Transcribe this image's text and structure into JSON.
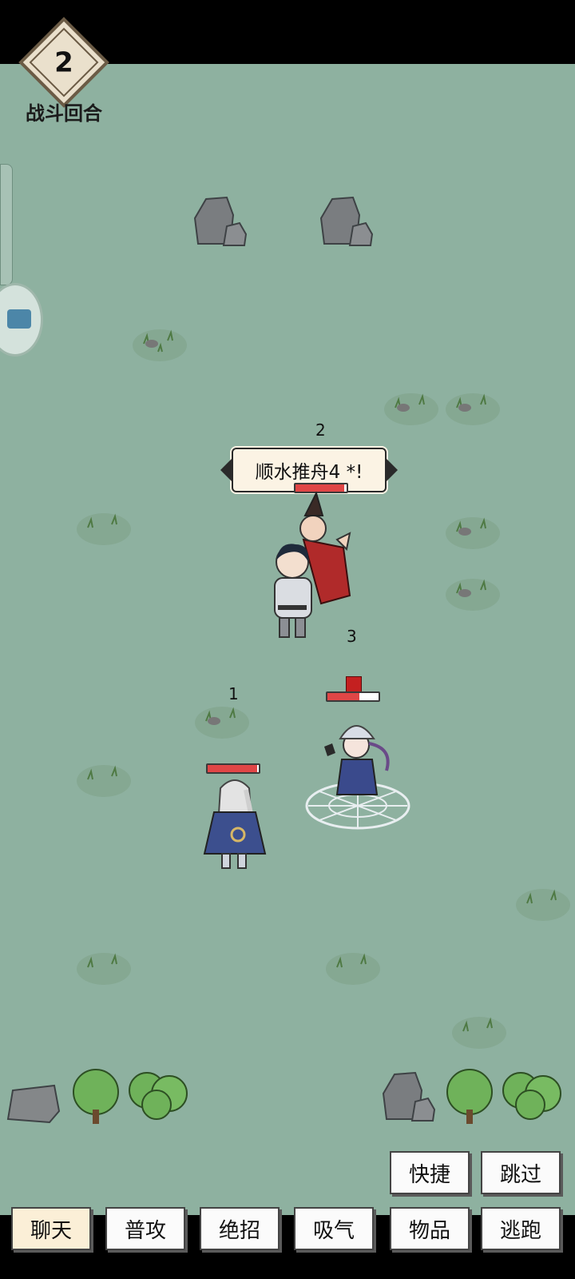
{
  "hud": {
    "round_number": "2",
    "round_label": "战斗回合"
  },
  "battle": {
    "skill_callout": "顺水推舟4 *!",
    "units": [
      {
        "slot": "2",
        "hp_fraction": 0.95
      },
      {
        "slot": "3",
        "hp_fraction": 0.62
      },
      {
        "slot": "1",
        "hp_fraction": 0.97
      }
    ]
  },
  "quick_buttons": {
    "shortcut": "快捷",
    "skip": "跳过"
  },
  "action_bar": {
    "chat": "聊天",
    "attack": "普攻",
    "ultimate": "绝招",
    "absorb_qi": "吸气",
    "items": "物品",
    "flee": "逃跑"
  },
  "colors": {
    "field": "#8eb1a0",
    "hp_red": "#e04646",
    "bubble": "#fbf3e4",
    "active_tab": "#fbefd7"
  }
}
